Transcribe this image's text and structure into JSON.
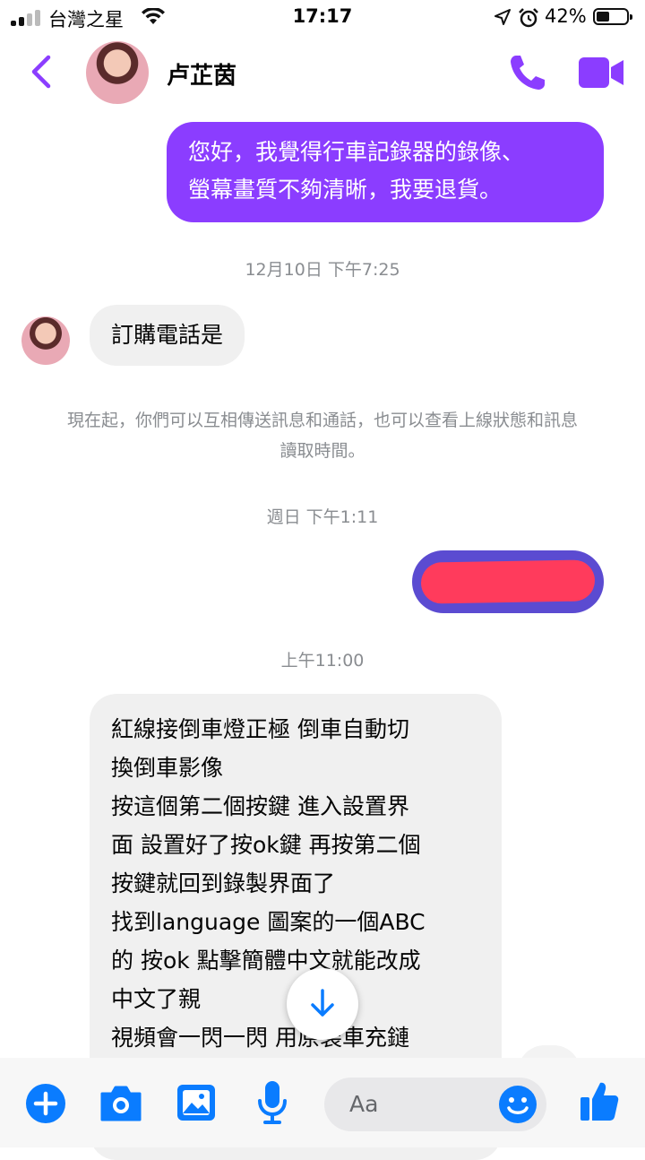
{
  "status_bar": {
    "carrier": "台灣之星",
    "time": "17:17",
    "battery": "42%"
  },
  "header": {
    "contact_name": "卢芷茵"
  },
  "messages": {
    "m1_lines": [
      "您好，我覺得行車記錄器的錄像、",
      "螢幕畫質不夠清晰，我要退貨。"
    ],
    "ts1": "12月10日 下午7:25",
    "m2": "訂購電話是",
    "notice_lines": [
      "現在起，你們可以互相傳送訊息和通話，也可以查看上線狀態和訊息",
      "讀取時間。"
    ],
    "ts2": "週日 下午1:11",
    "ts3": "上午11:00",
    "m4_lines": [
      "紅線接倒車燈正極 倒車自動切",
      "換倒車影像",
      "按這個第二個按鍵 進入設置界",
      "面 設置好了按ok鍵 再按第二個",
      "按鍵就回到錄製界面了",
      "找到language 圖案的一個ABC",
      "的 按ok 點擊簡體中文就能改成",
      "中文了親",
      "視頻會一閃一閃 用原裝車充鏈"
    ]
  },
  "composer": {
    "placeholder": "Aa"
  },
  "colors": {
    "accent": "#8b3dff",
    "incoming_bubble": "#f0f0f0",
    "messenger_blue": "#0a7cff"
  },
  "icons": [
    "back-icon",
    "call-icon",
    "video-icon",
    "plus-icon",
    "camera-icon",
    "gallery-icon",
    "mic-icon",
    "emoji-icon",
    "like-icon",
    "arrow-down-icon"
  ]
}
